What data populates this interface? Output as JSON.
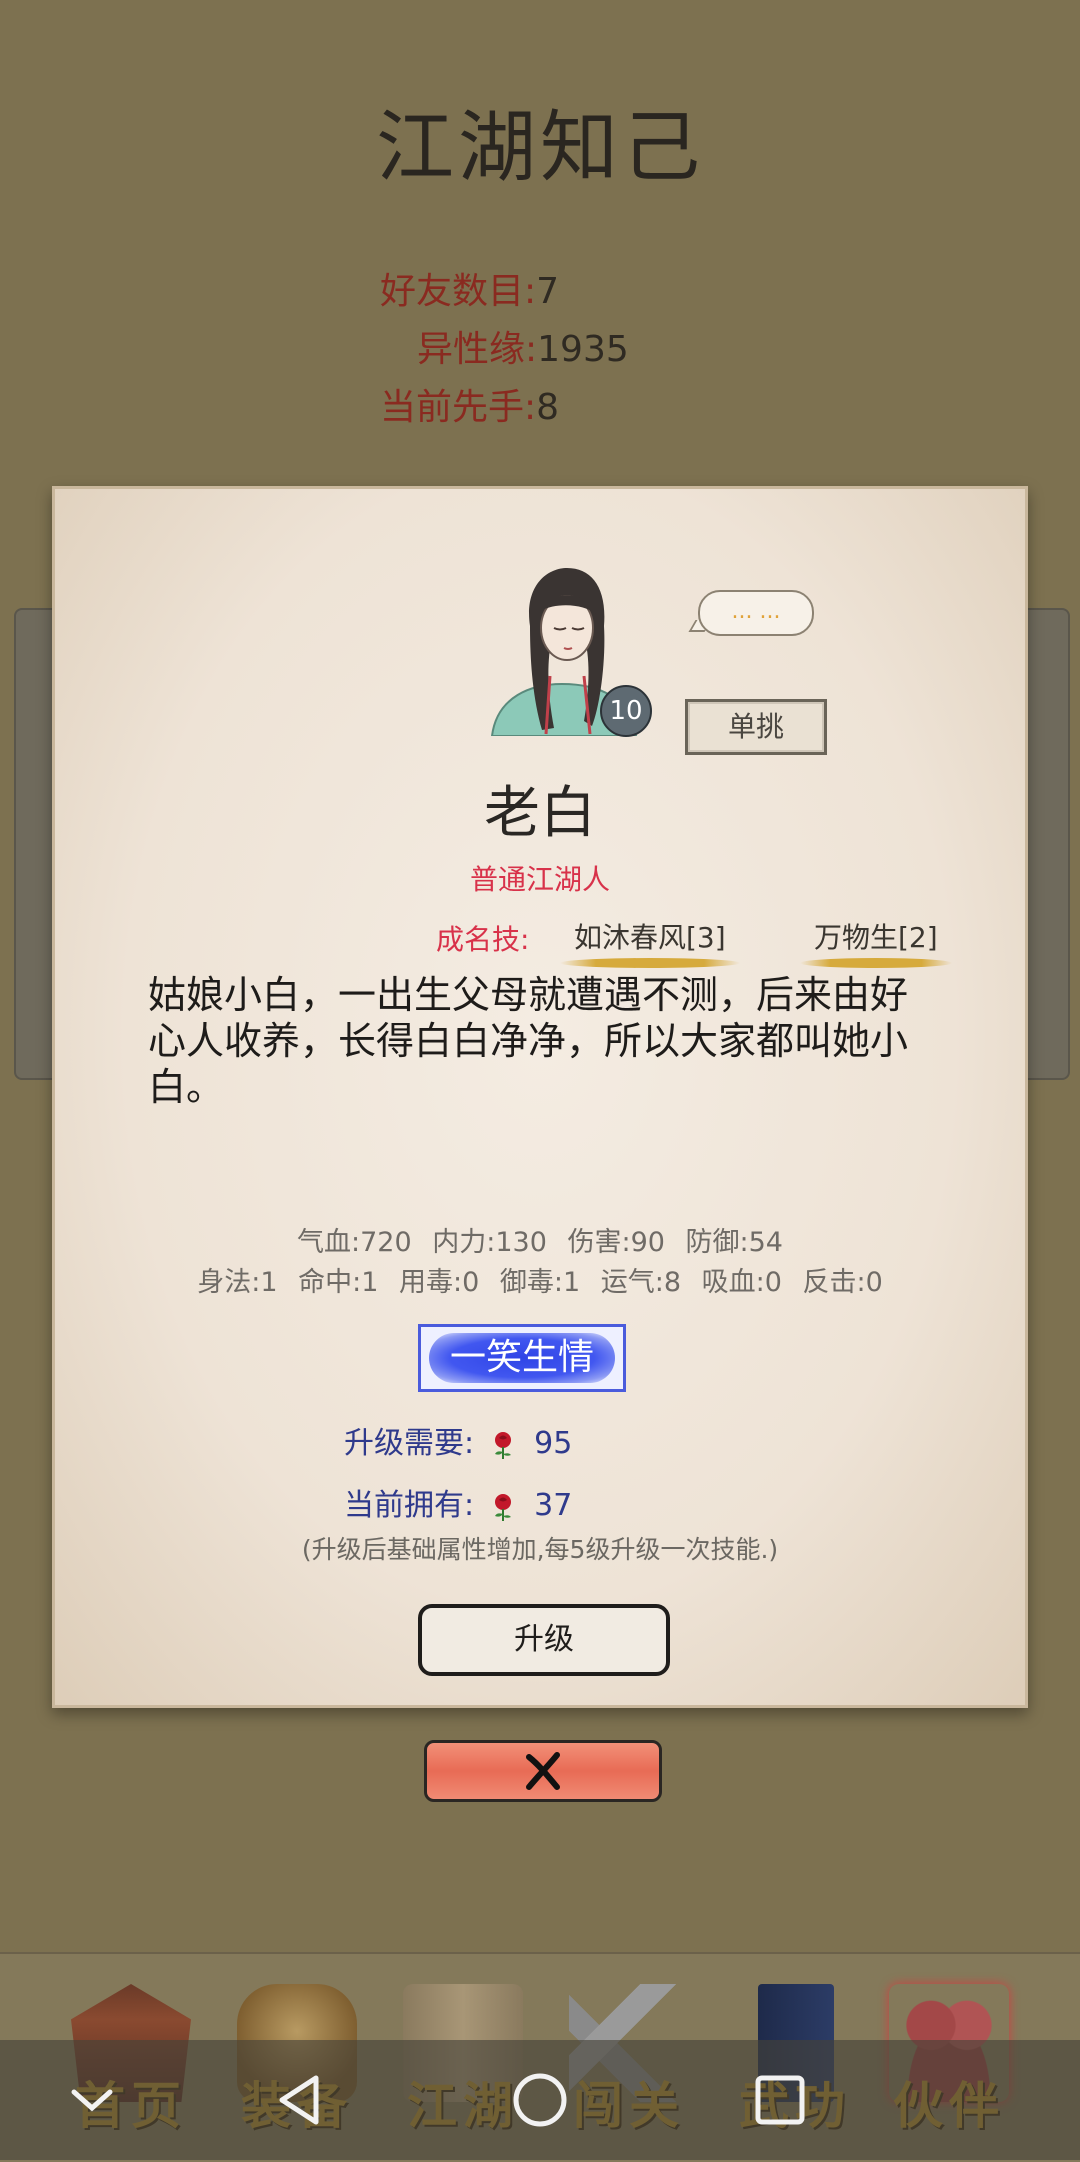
{
  "screen": {
    "title": "江湖知己",
    "stats": [
      {
        "label": "好友数目:",
        "value": "7"
      },
      {
        "label": "异性缘:",
        "value": "1935"
      },
      {
        "label": "当前先手:",
        "value": "8"
      }
    ]
  },
  "dialog": {
    "level": "10",
    "speech_bubble": "... ...",
    "duel_button": "单挑",
    "name": "老白",
    "type": "普通江湖人",
    "skills_label": "成名技:",
    "skills": [
      "如沐春风[3]",
      "万物生[2]"
    ],
    "description": "姑娘小白，一出生父母就遭遇不测，后来由好心人收养，长得白白净净，所以大家都叫她小白。",
    "attrs_line1": [
      "气血:720",
      "内力:130",
      "伤害:90",
      "防御:54"
    ],
    "attrs_line2": [
      "身法:1",
      "命中:1",
      "用毒:0",
      "御毒:1",
      "运气:8",
      "吸血:0",
      "反击:0"
    ],
    "charm_button": "一笑生情",
    "upgrade_need_label": "升级需要:",
    "upgrade_need_value": "95",
    "owned_label": "当前拥有:",
    "owned_value": "37",
    "note": "(升级后基础属性增加,每5级升级一次技能.)",
    "upgrade_button": "升级"
  },
  "tabbar": {
    "tabs": [
      {
        "label": "首页",
        "icon": "house-icon"
      },
      {
        "label": "装备",
        "icon": "armor-icon"
      },
      {
        "label": "江湖",
        "icon": "scroll-map-icon"
      },
      {
        "label": "闯关",
        "icon": "crossed-swords-icon"
      },
      {
        "label": "武功",
        "icon": "book-icon"
      },
      {
        "label": "伙伴",
        "icon": "partners-icon"
      }
    ]
  },
  "navbar": {
    "icons": [
      "collapse-chevron-icon",
      "back-icon",
      "home-icon",
      "recents-icon"
    ]
  },
  "colors": {
    "background": "#7d7150",
    "stat_label": "#8a2a20",
    "char_type": "#d8324a",
    "charm_button": "#3a4fe8",
    "close_button": "#e86b55",
    "tab_label": "#b58e2a"
  }
}
